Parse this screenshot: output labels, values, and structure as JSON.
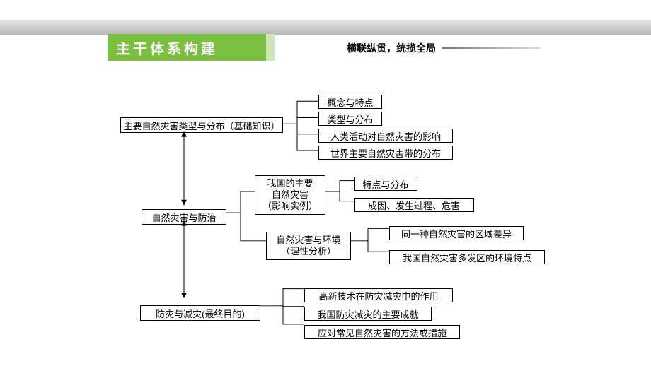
{
  "header": {
    "title": "主干体系构建",
    "subtitle": "横联纵贯，统揽全局"
  },
  "diagram": {
    "root": "自然灾害与防治",
    "branch1": {
      "label": "主要自然灾害类型与分布（基础知识）",
      "leaves": [
        "概念与特点",
        "类型与分布",
        "人类活动对自然灾害的影响",
        "世界主要自然灾害带的分布"
      ]
    },
    "branch2a": {
      "label": "我国的主要\n自然灾害\n（影响实例）",
      "leaves": [
        "特点与分布",
        "成因、发生过程、危害"
      ]
    },
    "branch2b": {
      "label": "自然灾害与环境\n（理性分析）",
      "leaves": [
        "同一种自然灾害的区域差异",
        "我国自然灾害多发区的环境特点"
      ]
    },
    "branch3": {
      "label": "防灾与减灾(最终目的)",
      "leaves": [
        "高新技术在防灾减灾中的作用",
        "我国防灾减灾的主要成就",
        "应对常见自然灾害的方法或措施"
      ]
    }
  }
}
